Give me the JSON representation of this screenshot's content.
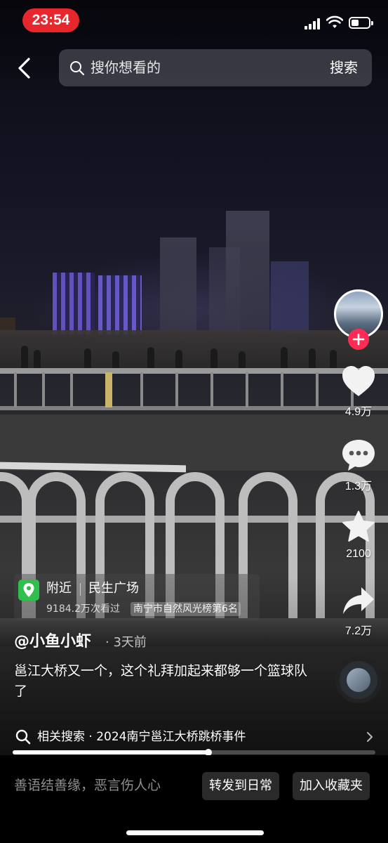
{
  "status_bar": {
    "time": "23:54",
    "time_pill_color": "#e8262e"
  },
  "search": {
    "placeholder": "搜你想看的",
    "button_label": "搜索"
  },
  "actions": {
    "likes": "4.9万",
    "comments": "1.3万",
    "favorites": "2100",
    "shares": "7.2万",
    "follow_color": "#fe2c55"
  },
  "location": {
    "prefix": "附近",
    "name": "民生广场",
    "views": "9184.2万次看过",
    "rank": "南宁市自然风光榜第6名",
    "icon_color": "#2fbf4d"
  },
  "post": {
    "author": "@小鱼小虾",
    "time_ago": "· 3天前",
    "caption": "邕江大桥又一个，这个礼拜加起来都够一个篮球队了"
  },
  "related_search": {
    "label": "相关搜索 · 2024南宁邕江大桥跳桥事件"
  },
  "playback": {
    "progress_fraction": 0.54
  },
  "bottom_bar": {
    "comment_placeholder": "善语结善缘，恶言伤人心",
    "share_to_daily": "转发到日常",
    "add_to_favorites": "加入收藏夹"
  }
}
